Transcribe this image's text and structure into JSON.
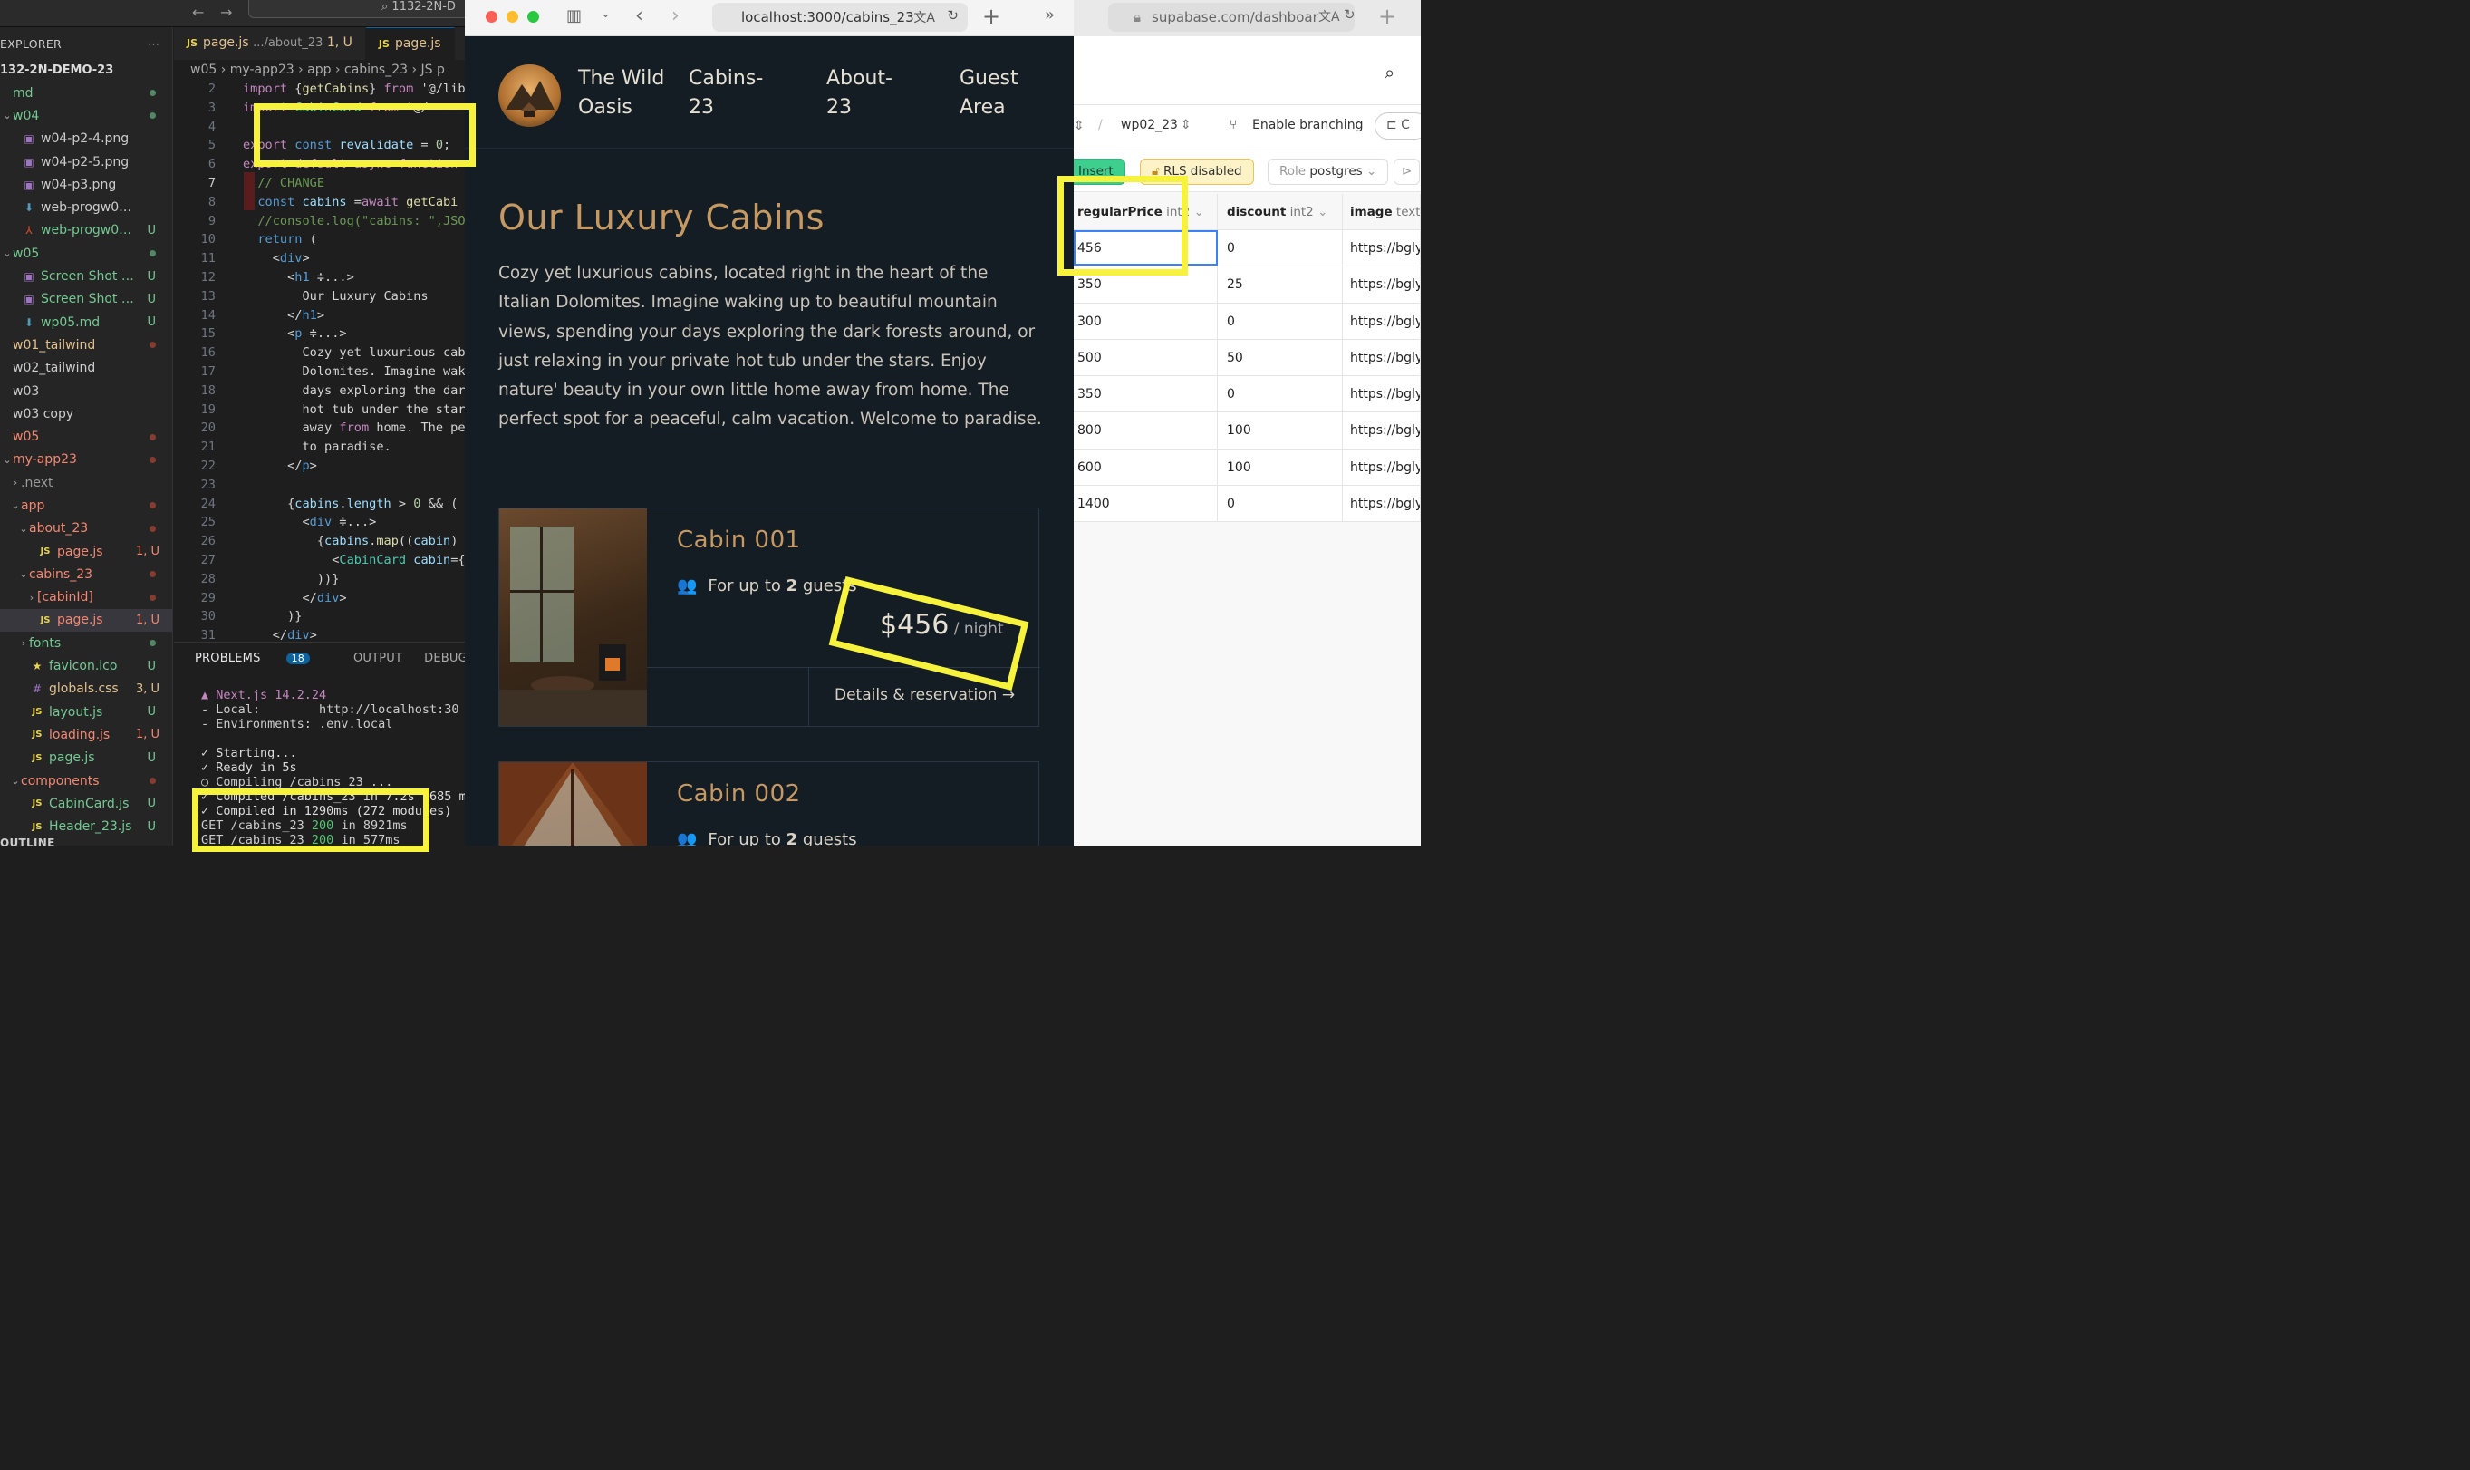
{
  "vscode": {
    "search_text": "1132-2N-D",
    "explorer_label": "EXPLORER",
    "more": "···",
    "root": "132-2N-DEMO-23",
    "tree": [
      {
        "name": "md",
        "cls": "g",
        "st": "dot",
        "tw": "",
        "ic": "",
        "ind": 0
      },
      {
        "name": "w04",
        "cls": "g",
        "st": "dot",
        "tw": "⌄",
        "ic": "",
        "ind": 0
      },
      {
        "name": "w04-p2-4.png",
        "cls": "wh",
        "st": "",
        "tw": "",
        "ic": "▣",
        "ind": 1
      },
      {
        "name": "w04-p2-5.png",
        "cls": "wh",
        "st": "",
        "tw": "",
        "ic": "▣",
        "ind": 1
      },
      {
        "name": "w04-p3.png",
        "cls": "wh",
        "st": "",
        "tw": "",
        "ic": "▣",
        "ind": 1
      },
      {
        "name": "web-progw04.md",
        "cls": "wh",
        "st": "",
        "tw": "",
        "ic": "⬇",
        "ind": 1
      },
      {
        "name": "web-progw04.pdf",
        "cls": "g",
        "st": "U",
        "tw": "",
        "ic": "⅄",
        "ind": 1
      },
      {
        "name": "w05",
        "cls": "g",
        "st": "dot",
        "tw": "⌄",
        "ic": "",
        "ind": 0
      },
      {
        "name": "Screen Shot 20...",
        "cls": "g",
        "st": "U",
        "tw": "",
        "ic": "▣",
        "ind": 1
      },
      {
        "name": "Screen Shot 20...",
        "cls": "g",
        "st": "U",
        "tw": "",
        "ic": "▣",
        "ind": 1
      },
      {
        "name": "wp05.md",
        "cls": "g",
        "st": "U",
        "tw": "",
        "ic": "⬇",
        "ind": 1
      },
      {
        "name": "w01_tailwind",
        "cls": "ye",
        "st": "dotr",
        "tw": "",
        "ic": "",
        "ind": 0
      },
      {
        "name": "w02_tailwind",
        "cls": "wh",
        "st": "",
        "tw": "",
        "ic": "",
        "ind": 0
      },
      {
        "name": "w03",
        "cls": "wh",
        "st": "",
        "tw": "",
        "ic": "",
        "ind": 0
      },
      {
        "name": "w03 copy",
        "cls": "wh",
        "st": "",
        "tw": "",
        "ic": "",
        "ind": 0
      },
      {
        "name": "w05",
        "cls": "rd",
        "st": "dotr",
        "tw": "",
        "ic": "",
        "ind": 0
      },
      {
        "name": "my-app23",
        "cls": "rd",
        "st": "dotr",
        "tw": "⌄",
        "ic": "",
        "ind": 0
      },
      {
        "name": ".next",
        "cls": "gr",
        "st": "",
        "tw": "›",
        "ic": "",
        "ind": 1
      },
      {
        "name": "app",
        "cls": "rd",
        "st": "dotr",
        "tw": "⌄",
        "ic": "",
        "ind": 1
      },
      {
        "name": "about_23",
        "cls": "rd",
        "st": "dotr",
        "tw": "⌄",
        "ic": "",
        "ind": 2
      },
      {
        "name": "page.js",
        "cls": "rd",
        "st": "1, U",
        "tw": "",
        "ic": "JS",
        "ind": 3
      },
      {
        "name": "cabins_23",
        "cls": "rd",
        "st": "dotr",
        "tw": "⌄",
        "ic": "",
        "ind": 2
      },
      {
        "name": "[cabinId]",
        "cls": "rd",
        "st": "dotr",
        "tw": "›",
        "ic": "",
        "ind": 3
      },
      {
        "name": "page.js",
        "cls": "rd",
        "st": "1, U",
        "tw": "",
        "ic": "JS",
        "ind": 3,
        "sel": true
      },
      {
        "name": "fonts",
        "cls": "g",
        "st": "dot",
        "tw": "›",
        "ic": "",
        "ind": 2
      },
      {
        "name": "favicon.ico",
        "cls": "g",
        "st": "U",
        "tw": "",
        "ic": "★",
        "ind": 2
      },
      {
        "name": "globals.css",
        "cls": "ye",
        "st": "3, U",
        "tw": "",
        "ic": "#",
        "ind": 2
      },
      {
        "name": "layout.js",
        "cls": "g",
        "st": "U",
        "tw": "",
        "ic": "JS",
        "ind": 2
      },
      {
        "name": "loading.js",
        "cls": "rd",
        "st": "1, U",
        "tw": "",
        "ic": "JS",
        "ind": 2
      },
      {
        "name": "page.js",
        "cls": "g",
        "st": "U",
        "tw": "",
        "ic": "JS",
        "ind": 2
      },
      {
        "name": "components",
        "cls": "rd",
        "st": "dotr",
        "tw": "⌄",
        "ic": "",
        "ind": 1
      },
      {
        "name": "CabinCard.js",
        "cls": "g",
        "st": "U",
        "tw": "",
        "ic": "JS",
        "ind": 2
      },
      {
        "name": "Header_23.js",
        "cls": "g",
        "st": "U",
        "tw": "",
        "ic": "JS",
        "ind": 2
      }
    ],
    "outline_label": "OUTLINE",
    "tab1": "page.js",
    "tab1_path": ".../about_23",
    "tab1_status": "1, U",
    "tab2": "page.js",
    "breadcrumb": "w05 › my-app23 › app › cabins_23 › JS p",
    "code_lines": [
      {
        "n": "2",
        "t": "import {getCabins} from '@/lib"
      },
      {
        "n": "3",
        "t": "import CabinCard from '@/"
      },
      {
        "n": "4",
        "t": ""
      },
      {
        "n": "5",
        "t": "export const revalidate = 0;"
      },
      {
        "n": "6",
        "t": "export default async function"
      },
      {
        "n": "7",
        "t": "  // CHANGE",
        "cur": true
      },
      {
        "n": "8",
        "t": "  const cabins =await getCabi"
      },
      {
        "n": "9",
        "t": "  //console.log(\"cabins: \",JSO"
      },
      {
        "n": "10",
        "t": "  return ("
      },
      {
        "n": "11",
        "t": "    <div>"
      },
      {
        "n": "12",
        "t": "      <h1 ≑...>"
      },
      {
        "n": "13",
        "t": "        Our Luxury Cabins"
      },
      {
        "n": "14",
        "t": "      </h1>"
      },
      {
        "n": "15",
        "t": "      <p ≑...>"
      },
      {
        "n": "16",
        "t": "        Cozy yet luxurious cab"
      },
      {
        "n": "17",
        "t": "        Dolomites. Imagine wak"
      },
      {
        "n": "18",
        "t": "        days exploring the dar"
      },
      {
        "n": "19",
        "t": "        hot tub under the star"
      },
      {
        "n": "20",
        "t": "        away from home. The pe"
      },
      {
        "n": "21",
        "t": "        to paradise."
      },
      {
        "n": "22",
        "t": "      </p>"
      },
      {
        "n": "23",
        "t": ""
      },
      {
        "n": "24",
        "t": "      {cabins.length > 0 && ("
      },
      {
        "n": "25",
        "t": "        <div ≑...>"
      },
      {
        "n": "26",
        "t": "          {cabins.map((cabin)"
      },
      {
        "n": "27",
        "t": "            <CabinCard cabin={"
      },
      {
        "n": "28",
        "t": "          ))}"
      },
      {
        "n": "29",
        "t": "        </div>"
      },
      {
        "n": "30",
        "t": "      )}"
      },
      {
        "n": "31",
        "t": "    </div>"
      }
    ],
    "panel_tabs": {
      "problems": "PROBLEMS",
      "problems_count": "18",
      "output": "OUTPUT",
      "debug": "DEBUG CONSO"
    },
    "terminal": [
      "▲ Next.js 14.2.24",
      "- Local:        http://localhost:30",
      "- Environments: .env.local",
      "",
      "✓ Starting...",
      "✓ Ready in 5s",
      "○ Compiling /cabins_23 ...",
      "✓ Compiled /cabins_23 in 7.2s (685 m",
      "✓ Compiled in 1290ms (272 modules)",
      "GET /cabins_23 200 in 8921ms",
      "GET /cabins_23 200 in 577ms"
    ]
  },
  "browser": {
    "url": "localhost:3000/cabins_23",
    "brand": "The Wild Oasis",
    "nav": [
      "Cabins-23",
      "About-23",
      "Guest Area"
    ],
    "title": "Our Luxury Cabins",
    "intro": "Cozy yet luxurious cabins, located right in the heart of the Italian Dolomites. Imagine waking up to beautiful mountain views, spending your days exploring the dark forests around, or just relaxing in your private hot tub under the stars. Enjoy nature' beauty in your own little home away from home. The perfect spot for a peaceful, calm vacation. Welcome to paradise.",
    "cards": [
      {
        "name": "Cabin 001",
        "guests_prefix": "For up to ",
        "guests": "2",
        "guests_suffix": " guests",
        "price": "$456",
        "per": " / night",
        "action": "Details & reservation →"
      },
      {
        "name": "Cabin 002",
        "guests_prefix": "For up to ",
        "guests": "2",
        "guests_suffix": " guests"
      }
    ]
  },
  "supabase": {
    "url": "supabase.com/dashboar",
    "table": "wp02_23",
    "branching": "Enable branching",
    "insert": "Insert",
    "rls": "RLS disabled",
    "role_label": "Role",
    "role": "postgres",
    "columns": [
      {
        "name": "regularPrice",
        "type": "int2"
      },
      {
        "name": "discount",
        "type": "int2"
      },
      {
        "name": "image",
        "type": "text"
      }
    ],
    "rows": [
      [
        "456",
        "0",
        "https://bgly"
      ],
      [
        "350",
        "25",
        "https://bgly"
      ],
      [
        "300",
        "0",
        "https://bgly"
      ],
      [
        "500",
        "50",
        "https://bgly"
      ],
      [
        "350",
        "0",
        "https://bgly"
      ],
      [
        "800",
        "100",
        "https://bgly"
      ],
      [
        "600",
        "100",
        "https://bgly"
      ],
      [
        "1400",
        "0",
        "https://bgly"
      ]
    ]
  },
  "highlight_color": "#f7f33c"
}
